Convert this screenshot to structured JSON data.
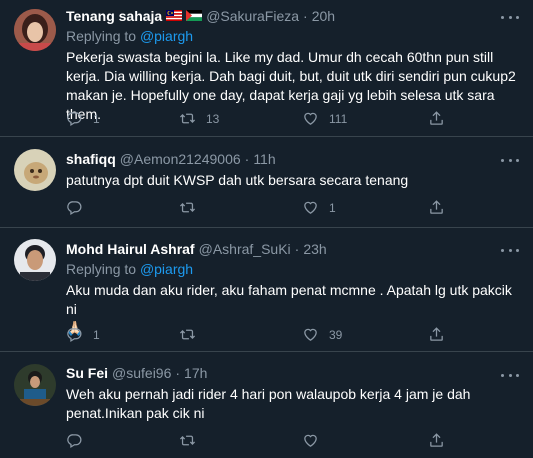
{
  "tweets": [
    {
      "name": "Tenang sahaja",
      "handle": "@SakuraFieza",
      "time": "20h",
      "replying_prefix": "Replying to",
      "replying_to": "@piargh",
      "text": "Pekerja swasta begini la. Like my dad. Umur dh cecah 60thn pun still kerja. Dia willing kerja. Dah bagi duit, but, duit utk diri sendiri pun cukup2 makan je. Hopefully one day, dapat kerja gaji yg lebih selesa utk sara them.",
      "replies": "1",
      "retweets": "13",
      "likes": "111"
    },
    {
      "name": "shafiqq",
      "handle": "@Aemon21249006",
      "time": "11h",
      "text": "patutnya dpt duit KWSP dah utk bersara secara tenang",
      "replies": "",
      "retweets": "",
      "likes": "1"
    },
    {
      "name": "Mohd Hairul Ashraf",
      "handle": "@Ashraf_SuKi",
      "time": "23h",
      "replying_prefix": "Replying to",
      "replying_to": "@piargh",
      "text": "Aku muda dan aku rider, aku faham penat mcmne . Apatah lg utk pakcik ni",
      "emoji": "🙏🏻",
      "replies": "1",
      "retweets": "",
      "likes": "39"
    },
    {
      "name": "Su Fei",
      "handle": "@sufei96",
      "time": "17h",
      "text": "Weh aku pernah jadi rider 4 hari pon walaupob kerja 4 jam je dah penat.Inikan pak cik ni",
      "replies": "",
      "retweets": "",
      "likes": ""
    }
  ],
  "separator": "·",
  "icons": {
    "reply": "reply-icon",
    "retweet": "retweet-icon",
    "like": "heart-icon",
    "share": "share-icon",
    "more": "more-icon",
    "flags": [
      "malaysia-flag-icon",
      "palestine-flag-icon"
    ]
  },
  "colors": {
    "background": "#15202b",
    "text": "#ffffff",
    "secondary": "#8b98a5",
    "link": "#1d9bf0",
    "divider": "#38444d"
  }
}
